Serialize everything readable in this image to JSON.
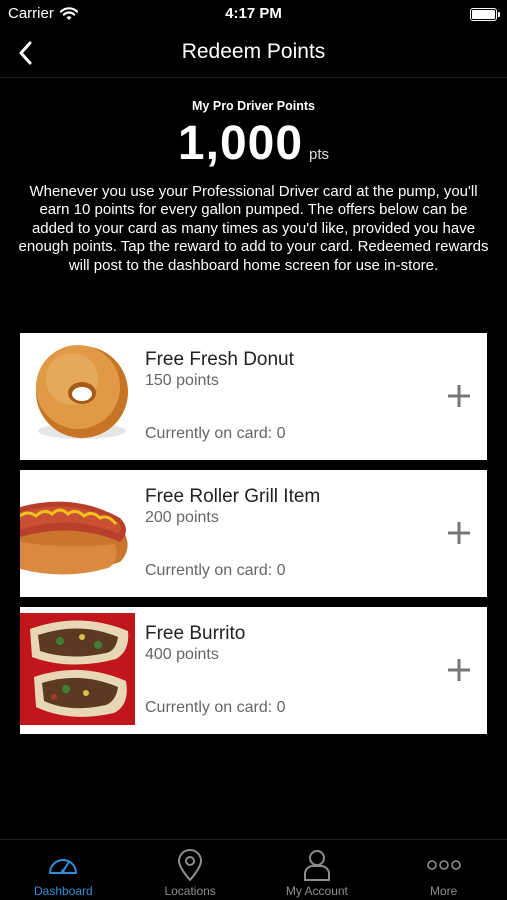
{
  "status_bar": {
    "carrier": "Carrier",
    "time": "4:17 PM"
  },
  "nav": {
    "title": "Redeem Points"
  },
  "points": {
    "label": "My Pro Driver Points",
    "value": "1,000",
    "unit": "pts"
  },
  "description": "Whenever you use your Professional Driver card at the pump, you'll earn 10 points for every gallon pumped. The offers below can be added to your card as many times as you'd like, provided you have enough points. Tap the reward to add to your card. Redeemed rewards will post to the dashboard home screen for use in-store.",
  "rewards": [
    {
      "title": "Free Fresh Donut",
      "points": "150 points",
      "on_card": "Currently on card: 0",
      "icon": "plus-icon"
    },
    {
      "title": "Free Roller Grill Item",
      "points": "200 points",
      "on_card": "Currently on card: 0",
      "icon": "plus-icon"
    },
    {
      "title": "Free Burrito",
      "points": "400 points",
      "on_card": "Currently on card: 0",
      "icon": "plus-icon"
    }
  ],
  "tabs": [
    {
      "label": "Dashboard",
      "icon": "dashboard-gauge-icon",
      "active": true
    },
    {
      "label": "Locations",
      "icon": "location-pin-icon",
      "active": false
    },
    {
      "label": "My Account",
      "icon": "person-icon",
      "active": false
    },
    {
      "label": "More",
      "icon": "more-dots-icon",
      "active": false
    }
  ],
  "colors": {
    "background": "#000000",
    "card": "#ffffff",
    "accent": "#2f8fd8",
    "inactive_tab": "#8e8e8e"
  }
}
